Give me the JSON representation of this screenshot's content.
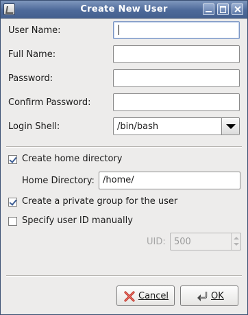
{
  "window": {
    "title": "Create New User"
  },
  "form": {
    "user_name_label": "User Name:",
    "full_name_label": "Full Name:",
    "password_label": "Password:",
    "confirm_password_label": "Confirm Password:",
    "login_shell_label": "Login Shell:",
    "user_name_value": "",
    "full_name_value": "",
    "password_value": "",
    "confirm_password_value": "",
    "login_shell_value": "/bin/bash"
  },
  "options": {
    "create_home_label": "Create home directory",
    "create_home_checked": true,
    "home_dir_label": "Home Directory:",
    "home_dir_value": "/home/",
    "private_group_label": "Create a private group for the user",
    "private_group_checked": true,
    "specify_uid_label": "Specify user ID manually",
    "specify_uid_checked": false,
    "uid_label": "UID:",
    "uid_value": "500"
  },
  "buttons": {
    "cancel_label": "Cancel",
    "ok_label": "OK"
  },
  "colors": {
    "titlebar": "#4e6a9a",
    "window_bg": "#edeceb",
    "check_mark": "#3b5c93",
    "cancel_icon": "#c0392b"
  }
}
